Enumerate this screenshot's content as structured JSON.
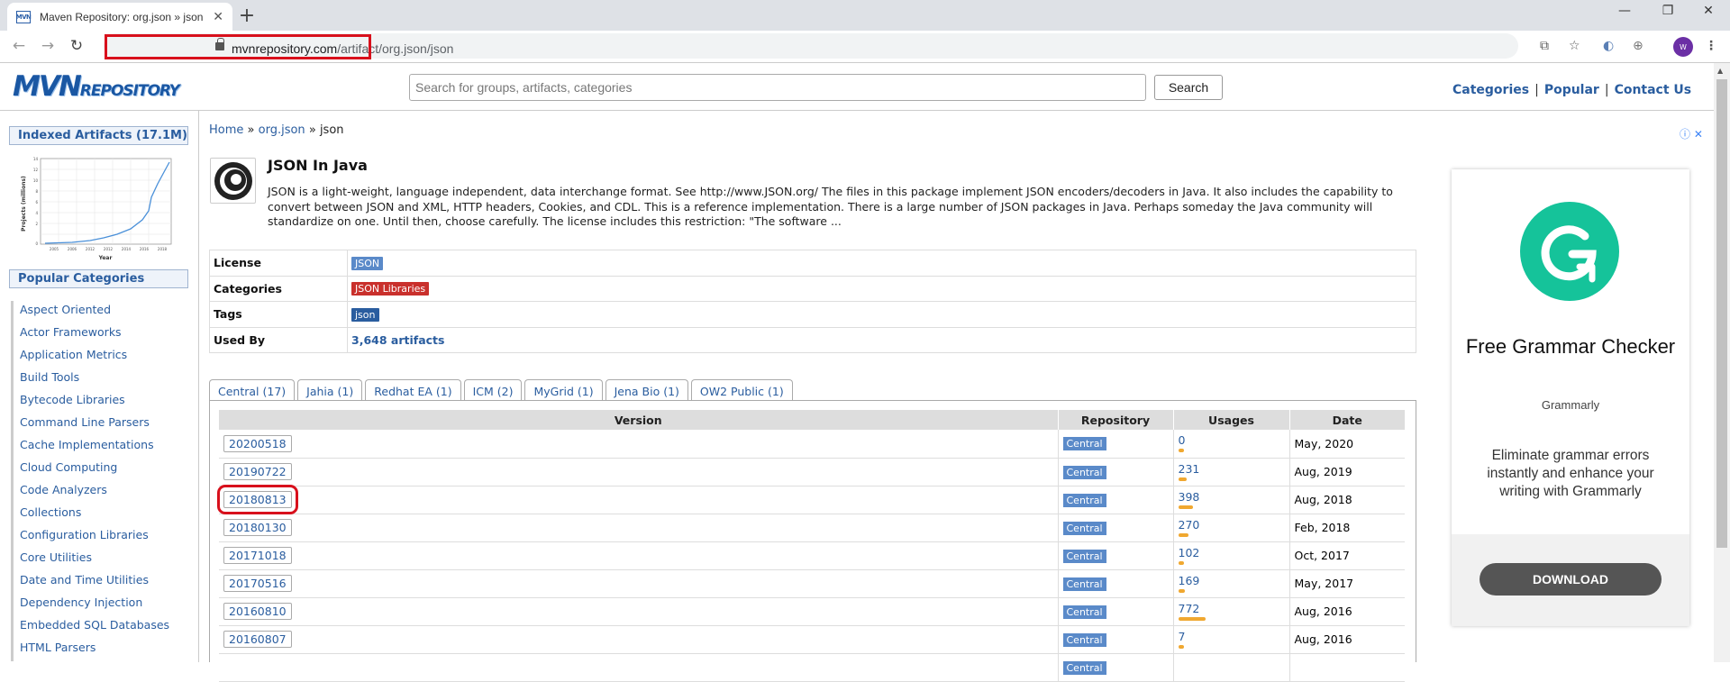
{
  "browser": {
    "tab_title": "Maven Repository: org.json » json",
    "favicon_text": "MVN",
    "new_tab": "+",
    "url_domain": "mvnrepository.com",
    "url_path": "/artifact/org.json/json",
    "avatar_text": "W",
    "window_controls": [
      "—",
      "❐",
      "✕"
    ]
  },
  "header": {
    "logo_big": "MVN",
    "logo_small": "REPOSITORY",
    "search_placeholder": "Search for groups, artifacts, categories",
    "search_button": "Search",
    "links": [
      "Categories",
      "Popular",
      "Contact Us"
    ],
    "separator": "|"
  },
  "sidebar": {
    "indexed_title": "Indexed Artifacts (17.1M)",
    "chart_ylabel": "Projects (millions)",
    "chart_xlabel": "Year",
    "chart_yticks": [
      "14",
      "12",
      "10",
      "8",
      "6",
      "4",
      "2",
      "0"
    ],
    "chart_xticks": [
      "2005",
      "2006",
      "2012",
      "2012",
      "2014",
      "2016",
      "2018"
    ],
    "popular_title": "Popular Categories",
    "categories": [
      "Aspect Oriented",
      "Actor Frameworks",
      "Application Metrics",
      "Build Tools",
      "Bytecode Libraries",
      "Command Line Parsers",
      "Cache Implementations",
      "Cloud Computing",
      "Code Analyzers",
      "Collections",
      "Configuration Libraries",
      "Core Utilities",
      "Date and Time Utilities",
      "Dependency Injection",
      "Embedded SQL Databases",
      "HTML Parsers"
    ]
  },
  "breadcrumb": {
    "home": "Home",
    "sep": "»",
    "group": "org.json",
    "artifact": "json"
  },
  "artifact": {
    "title": "JSON In Java",
    "description": "JSON is a light-weight, language independent, data interchange format. See http://www.JSON.org/ The files in this package implement JSON encoders/decoders in Java. It also includes the capability to convert between JSON and XML, HTTP headers, Cookies, and CDL. This is a reference implementation. There is a large number of JSON packages in Java. Perhaps someday the Java community will standardize on one. Until then, choose carefully. The license includes this restriction: \"The software ...",
    "license_label": "License",
    "license": "JSON",
    "categories_label": "Categories",
    "category": "JSON Libraries",
    "tags_label": "Tags",
    "tag": "json",
    "usedby_label": "Used By",
    "usedby": "3,648 artifacts"
  },
  "repo_tabs": [
    "Central (17)",
    "Jahia (1)",
    "Redhat EA (1)",
    "ICM (2)",
    "MyGrid (1)",
    "Jena Bio (1)",
    "OW2 Public (1)"
  ],
  "versions": {
    "headers": [
      "Version",
      "Repository",
      "Usages",
      "Date"
    ],
    "rows": [
      {
        "version": "20200518",
        "repo": "Central",
        "usages": "0",
        "usage_fraction": 0.01,
        "date": "May, 2020"
      },
      {
        "version": "20190722",
        "repo": "Central",
        "usages": "231",
        "usage_fraction": 0.3,
        "date": "Aug, 2019"
      },
      {
        "version": "20180813",
        "repo": "Central",
        "usages": "398",
        "usage_fraction": 0.52,
        "date": "Aug, 2018"
      },
      {
        "version": "20180130",
        "repo": "Central",
        "usages": "270",
        "usage_fraction": 0.35,
        "date": "Feb, 2018"
      },
      {
        "version": "20171018",
        "repo": "Central",
        "usages": "102",
        "usage_fraction": 0.13,
        "date": "Oct, 2017"
      },
      {
        "version": "20170516",
        "repo": "Central",
        "usages": "169",
        "usage_fraction": 0.22,
        "date": "May, 2017"
      },
      {
        "version": "20160810",
        "repo": "Central",
        "usages": "772",
        "usage_fraction": 1.0,
        "date": "Aug, 2016"
      },
      {
        "version": "20160807",
        "repo": "Central",
        "usages": "7",
        "usage_fraction": 0.01,
        "date": "Aug, 2016"
      },
      {
        "version": "",
        "repo": "Central",
        "usages": "",
        "usage_fraction": 0,
        "date": ""
      }
    ]
  },
  "ad": {
    "title": "Free Grammar Checker",
    "sponsor": "Grammarly",
    "text": "Eliminate grammar errors instantly and enhance your writing with Grammarly",
    "button": "DOWNLOAD",
    "close_icons": "ⓘ ✕"
  },
  "colors": {
    "link": "#2a5d9f",
    "highlight": "#d8101c",
    "grammarly": "#15c39a",
    "usage_bar": "#f0a830"
  }
}
